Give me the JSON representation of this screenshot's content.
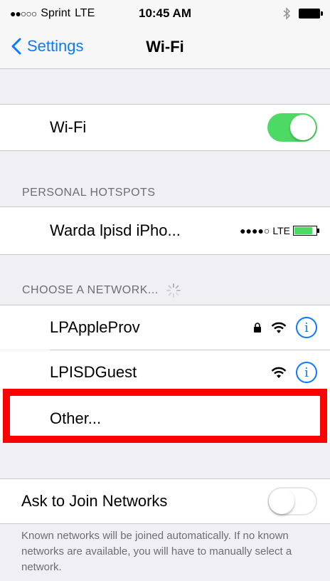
{
  "status_bar": {
    "signal_dots": "●●○○○",
    "carrier": "Sprint",
    "network": "LTE",
    "time": "10:45 AM",
    "bluetooth": "bluetooth-icon",
    "battery": "battery-icon"
  },
  "nav": {
    "back_label": "Settings",
    "title": "Wi-Fi"
  },
  "wifi": {
    "label": "Wi-Fi",
    "enabled": true
  },
  "personal_hotspots": {
    "header": "PERSONAL HOTSPOTS",
    "item": {
      "name": "Warda lpisd iPho...",
      "signal_dots": "●●●●○",
      "network": "LTE"
    }
  },
  "choose_network": {
    "header": "CHOOSE A NETWORK...",
    "networks": [
      {
        "name": "LPAppleProv",
        "secured": true
      },
      {
        "name": "LPISDGuest",
        "secured": false
      }
    ],
    "other_label": "Other..."
  },
  "ask_to_join": {
    "label": "Ask to Join Networks",
    "enabled": false
  },
  "footer_text": "Known networks will be joined automatically. If no known networks are available, you will have to manually select a network.",
  "colors": {
    "accent": "#0a7aff",
    "toggle_on": "#4cd964",
    "highlight_box": "#ff0000",
    "background": "#efeff4"
  }
}
